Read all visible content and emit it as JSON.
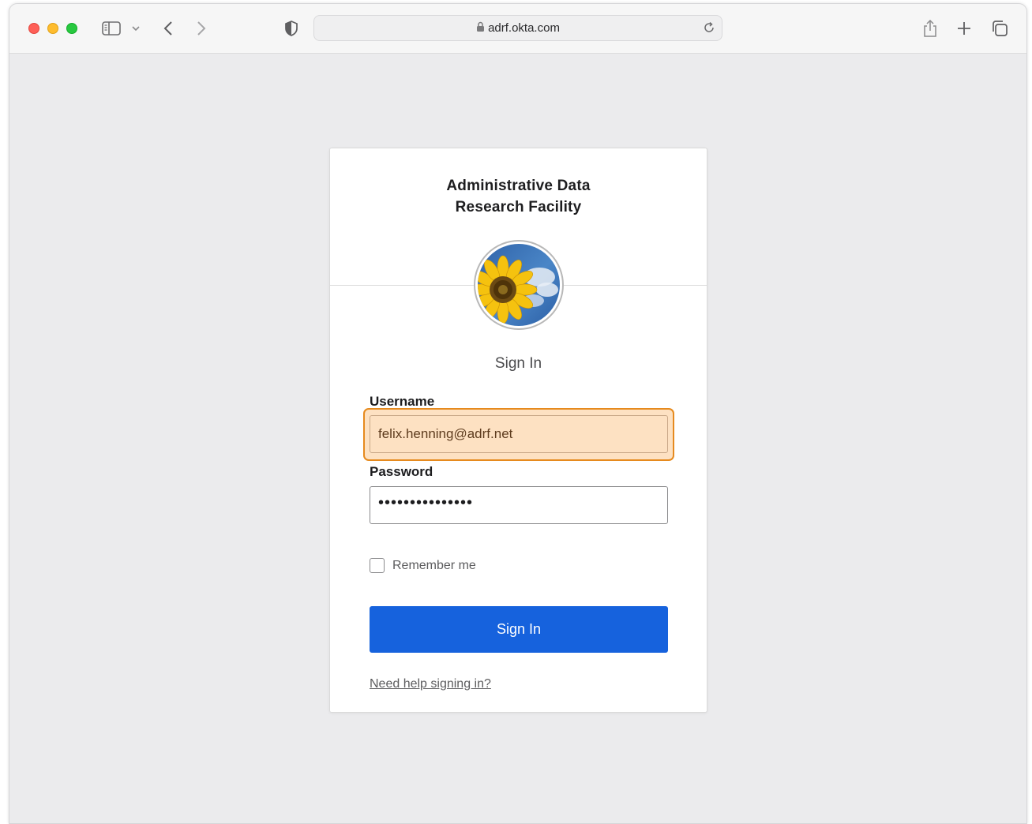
{
  "browser": {
    "url": "adrf.okta.com",
    "icons": [
      "sidebar-icon",
      "chevron-down-icon",
      "back-icon",
      "forward-icon",
      "shield-icon",
      "lock-icon",
      "reload-icon",
      "share-icon",
      "new-tab-icon",
      "tabs-overview-icon"
    ]
  },
  "card": {
    "org_title_line1": "Administrative Data",
    "org_title_line2": "Research Facility",
    "logo_icon": "sunflower-logo",
    "heading": "Sign In"
  },
  "form": {
    "username_label": "Username",
    "username_value": "felix.henning@adrf.net",
    "password_label": "Password",
    "password_value": "•••••••••••••••",
    "remember_label": "Remember me",
    "submit_label": "Sign In",
    "help_link": "Need help signing in?"
  },
  "colors": {
    "primary_button": "#1662dd",
    "highlight_border": "#e68a1e",
    "highlight_fill": "#fde1c2",
    "page_background": "#ebebed"
  }
}
